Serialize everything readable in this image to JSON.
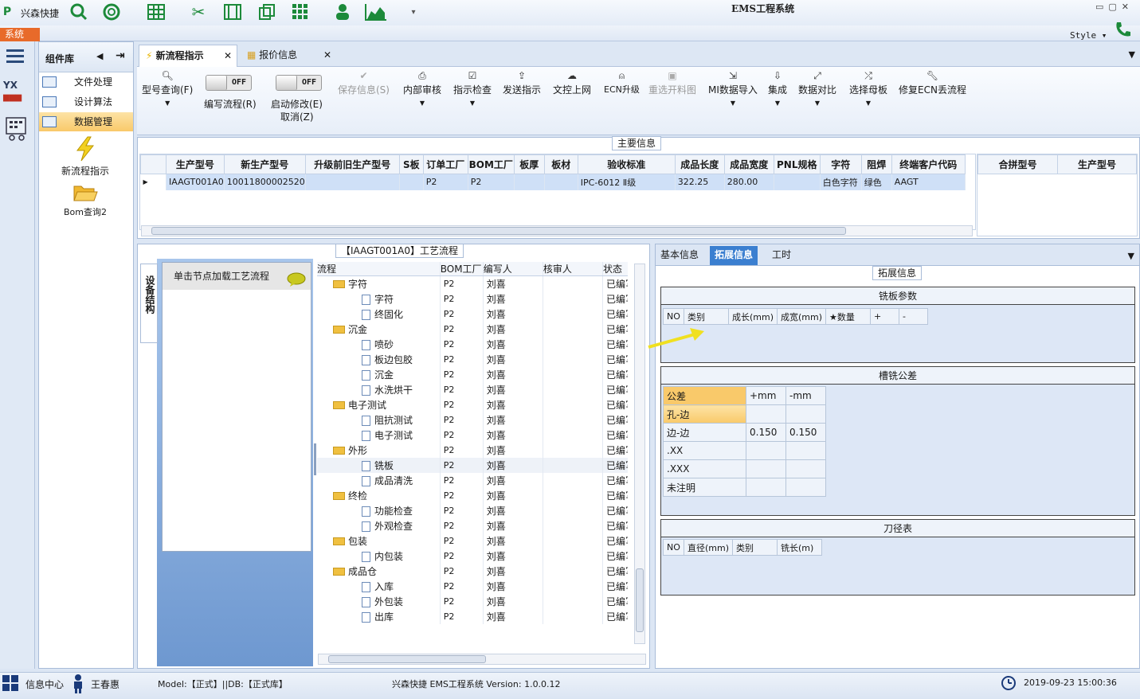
{
  "app": {
    "name": "兴森快捷",
    "window_title": "EMS工程系统",
    "system_tab": "系统",
    "style_label": "Style"
  },
  "component_library": {
    "title": "组件库",
    "items": [
      "文件处理",
      "设计算法",
      "数据管理"
    ],
    "selected": "数据管理",
    "shortcuts": [
      "新流程指示",
      "Bom查询2"
    ]
  },
  "doc_tabs": [
    {
      "label": "新流程指示",
      "active": true
    },
    {
      "label": "报价信息",
      "active": false
    }
  ],
  "ribbon": {
    "model_query": "型号查询(F)",
    "edit_flow_toggle": "OFF",
    "edit_flow": "编写流程(R)",
    "start_modify_toggle": "OFF",
    "start_modify": "启动修改(E)",
    "cancel": "取消(Z)",
    "save_info": "保存信息(S)",
    "internal_review": "内部审核",
    "indicate_check": "指示检查",
    "send_indicate": "发送指示",
    "doc_upload": "文控上网",
    "ecn_upgrade": "ECN升级",
    "draw_cut_map": "重选开料图",
    "mi_import": "MI数据导入",
    "integrate": "集成",
    "data_compare": "数据对比",
    "choose_mother": "选择母板",
    "fix_ecn": "修复ECN丢流程"
  },
  "main_info": {
    "label": "主要信息",
    "columns": [
      "生产型号",
      "新生产型号",
      "升级前旧生产型号",
      "S板",
      "订单工厂",
      "BOM工厂",
      "板厚",
      "板材",
      "验收标准",
      "成品长度",
      "成品宽度",
      "PNL规格",
      "字符",
      "阻焊",
      "终端客户代码"
    ],
    "rows": [
      [
        "IAAGT001A0",
        "10011800002520",
        "",
        "",
        "P2",
        "P2",
        "",
        "",
        "IPC-6012 Ⅱ级",
        "322.25",
        "280.00",
        "",
        "白色字符",
        "绿色",
        "AAGT"
      ]
    ],
    "side_columns": [
      "合拼型号",
      "生产型号"
    ]
  },
  "flow_panel": {
    "label": "【IAAGT001A0】工艺流程",
    "side_tab": "设备结构",
    "hint": "单击节点加载工艺流程",
    "columns": [
      "流程",
      "BOM工厂",
      "编写人",
      "核审人",
      "状态"
    ],
    "rows": [
      {
        "name": "字符",
        "level": 0,
        "bom": "P2",
        "writer": "刘喜",
        "status": "已编写"
      },
      {
        "name": "字符",
        "level": 1,
        "bom": "P2",
        "writer": "刘喜",
        "status": "已编写"
      },
      {
        "name": "终固化",
        "level": 1,
        "bom": "P2",
        "writer": "刘喜",
        "status": "已编写"
      },
      {
        "name": "沉金",
        "level": 0,
        "bom": "P2",
        "writer": "刘喜",
        "status": "已编写"
      },
      {
        "name": "喷砂",
        "level": 1,
        "bom": "P2",
        "writer": "刘喜",
        "status": "已编写"
      },
      {
        "name": "板边包胶",
        "level": 1,
        "bom": "P2",
        "writer": "刘喜",
        "status": "已编写"
      },
      {
        "name": "沉金",
        "level": 1,
        "bom": "P2",
        "writer": "刘喜",
        "status": "已编写"
      },
      {
        "name": "水洗烘干",
        "level": 1,
        "bom": "P2",
        "writer": "刘喜",
        "status": "已编写"
      },
      {
        "name": "电子测试",
        "level": 0,
        "bom": "P2",
        "writer": "刘喜",
        "status": "已编写"
      },
      {
        "name": "阻抗测试",
        "level": 1,
        "bom": "P2",
        "writer": "刘喜",
        "status": "已编写"
      },
      {
        "name": "电子测试",
        "level": 1,
        "bom": "P2",
        "writer": "刘喜",
        "status": "已编写"
      },
      {
        "name": "外形",
        "level": 0,
        "bom": "P2",
        "writer": "刘喜",
        "status": "已编写"
      },
      {
        "name": "铣板",
        "level": 1,
        "bom": "P2",
        "writer": "刘喜",
        "status": "已编写",
        "selected": true
      },
      {
        "name": "成品清洗",
        "level": 1,
        "bom": "P2",
        "writer": "刘喜",
        "status": "已编写"
      },
      {
        "name": "终检",
        "level": 0,
        "bom": "P2",
        "writer": "刘喜",
        "status": "已编写"
      },
      {
        "name": "功能检查",
        "level": 1,
        "bom": "P2",
        "writer": "刘喜",
        "status": "已编写"
      },
      {
        "name": "外观检查",
        "level": 1,
        "bom": "P2",
        "writer": "刘喜",
        "status": "已编写"
      },
      {
        "name": "包装",
        "level": 0,
        "bom": "P2",
        "writer": "刘喜",
        "status": "已编写"
      },
      {
        "name": "内包装",
        "level": 1,
        "bom": "P2",
        "writer": "刘喜",
        "status": "已编写"
      },
      {
        "name": "成品仓",
        "level": 0,
        "bom": "P2",
        "writer": "刘喜",
        "status": "已编写"
      },
      {
        "name": "入库",
        "level": 1,
        "bom": "P2",
        "writer": "刘喜",
        "status": "已编写"
      },
      {
        "name": "外包装",
        "level": 1,
        "bom": "P2",
        "writer": "刘喜",
        "status": "已编写"
      },
      {
        "name": "出库",
        "level": 1,
        "bom": "P2",
        "writer": "刘喜",
        "status": "已编写"
      }
    ]
  },
  "right_panel": {
    "tabs": [
      "基本信息",
      "拓展信息",
      "工时"
    ],
    "active_tab": "拓展信息",
    "label": "拓展信息",
    "mill_params": {
      "title": "铣板参数",
      "columns": [
        "NO",
        "类别",
        "成长(mm)",
        "成宽(mm)",
        "★数量",
        "+",
        "-"
      ]
    },
    "slot_tolerance": {
      "title": "槽铣公差",
      "columns": [
        "公差",
        "+mm",
        "-mm"
      ],
      "rows": [
        [
          "孔-边",
          "",
          ""
        ],
        [
          "边-边",
          "0.150",
          "0.150"
        ],
        [
          ".XX",
          "",
          ""
        ],
        [
          ".XXX",
          "",
          ""
        ],
        [
          "未注明",
          "",
          ""
        ]
      ]
    },
    "tool_table": {
      "title": "刀径表",
      "columns": [
        "NO",
        "直径(mm)",
        "类别",
        "铣长(m)"
      ]
    }
  },
  "status_bar": {
    "info_center": "信息中心",
    "user": "王春惠",
    "model_text": "Model:【正式】||DB:【正式库】",
    "version_text": "兴森快捷 EMS工程系统 Version: 1.0.0.12",
    "datetime": "2019-09-23 15:00:36"
  },
  "colors": {
    "accent": "#3b7fd0",
    "selected_row": "#cfe0f7",
    "highlight": "#f9c96a",
    "system_tab": "#e86a2a",
    "arrow": "#f0e020"
  }
}
